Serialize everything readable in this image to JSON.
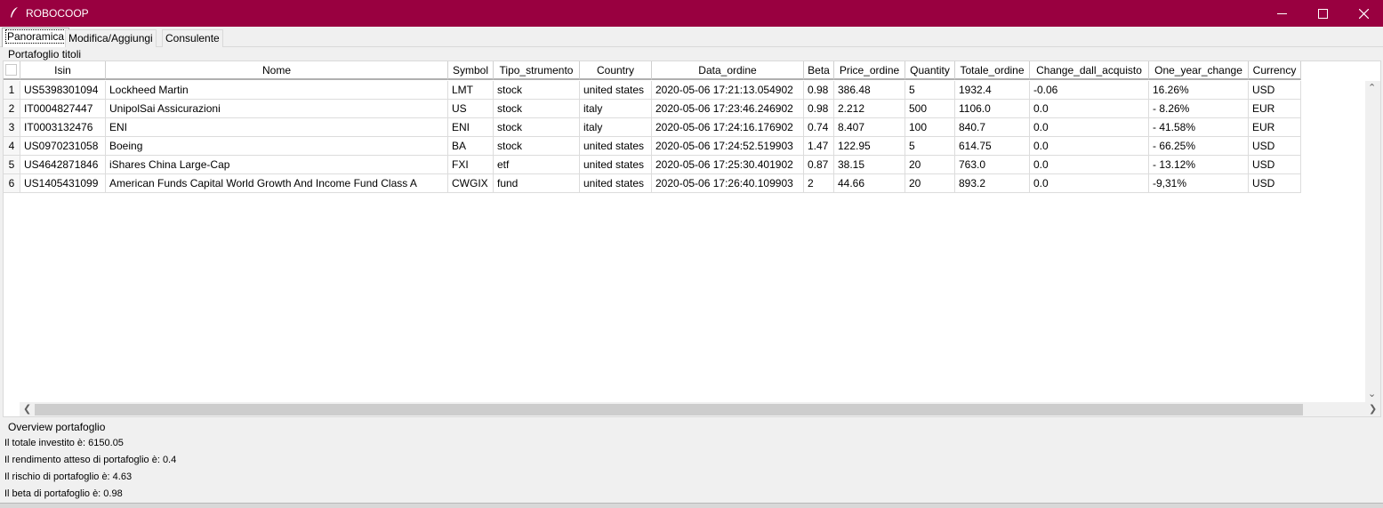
{
  "window": {
    "title": "ROBOCOOP",
    "icon": "feather-icon",
    "accent": "#990040"
  },
  "tabs": [
    {
      "label": "Panoramica",
      "active": true
    },
    {
      "label": "Modifica/Aggiungi",
      "active": false
    },
    {
      "label": "Consulente",
      "active": false
    }
  ],
  "portfolio": {
    "label": "Portafoglio titoli",
    "columns": [
      "Isin",
      "Nome",
      "Symbol",
      "Tipo_strumento",
      "Country",
      "Data_ordine",
      "Beta",
      "Price_ordine",
      "Quantity",
      "Totale_ordine",
      "Change_dall_acquisto",
      "One_year_change",
      "Currency"
    ],
    "rows": [
      {
        "index": "1",
        "cells": [
          "US5398301094",
          "Lockheed Martin",
          "LMT",
          "stock",
          "united states",
          "2020-05-06 17:21:13.054902",
          "0.98",
          "386.48",
          "5",
          "1932.4",
          "-0.06",
          "16.26%",
          "USD"
        ]
      },
      {
        "index": "2",
        "cells": [
          "IT0004827447",
          "UnipolSai Assicurazioni",
          "US",
          "stock",
          "italy",
          "2020-05-06 17:23:46.246902",
          "0.98",
          "2.212",
          "500",
          "1106.0",
          "0.0",
          "- 8.26%",
          "EUR"
        ]
      },
      {
        "index": "3",
        "cells": [
          "IT0003132476",
          "ENI",
          "ENI",
          "stock",
          "italy",
          "2020-05-06 17:24:16.176902",
          "0.74",
          "8.407",
          "100",
          "840.7",
          "0.0",
          "- 41.58%",
          "EUR"
        ]
      },
      {
        "index": "4",
        "cells": [
          "US0970231058",
          "Boeing",
          "BA",
          "stock",
          "united states",
          "2020-05-06 17:24:52.519903",
          "1.47",
          "122.95",
          "5",
          "614.75",
          "0.0",
          "- 66.25%",
          "USD"
        ]
      },
      {
        "index": "5",
        "cells": [
          "US4642871846",
          "iShares China Large-Cap",
          "FXI",
          "etf",
          "united states",
          "2020-05-06 17:25:30.401902",
          "0.87",
          "38.15",
          "20",
          "763.0",
          "0.0",
          "- 13.12%",
          "USD"
        ]
      },
      {
        "index": "6",
        "cells": [
          "US1405431099",
          "American Funds Capital World Growth And Income Fund Class A",
          "CWGIX",
          "fund",
          "united states",
          "2020-05-06 17:26:40.109903",
          "2",
          "44.66",
          "20",
          "893.2",
          "0.0",
          "-9,31%",
          "USD"
        ]
      }
    ]
  },
  "overview": {
    "label": "Overview portafoglio",
    "lines": [
      "Il totale investito è: 6150.05",
      "Il rendimento atteso di portafoglio è: 0.4",
      "Il rischio di portafoglio è: 4.63",
      "Il beta di portafoglio è: 0.98"
    ]
  }
}
